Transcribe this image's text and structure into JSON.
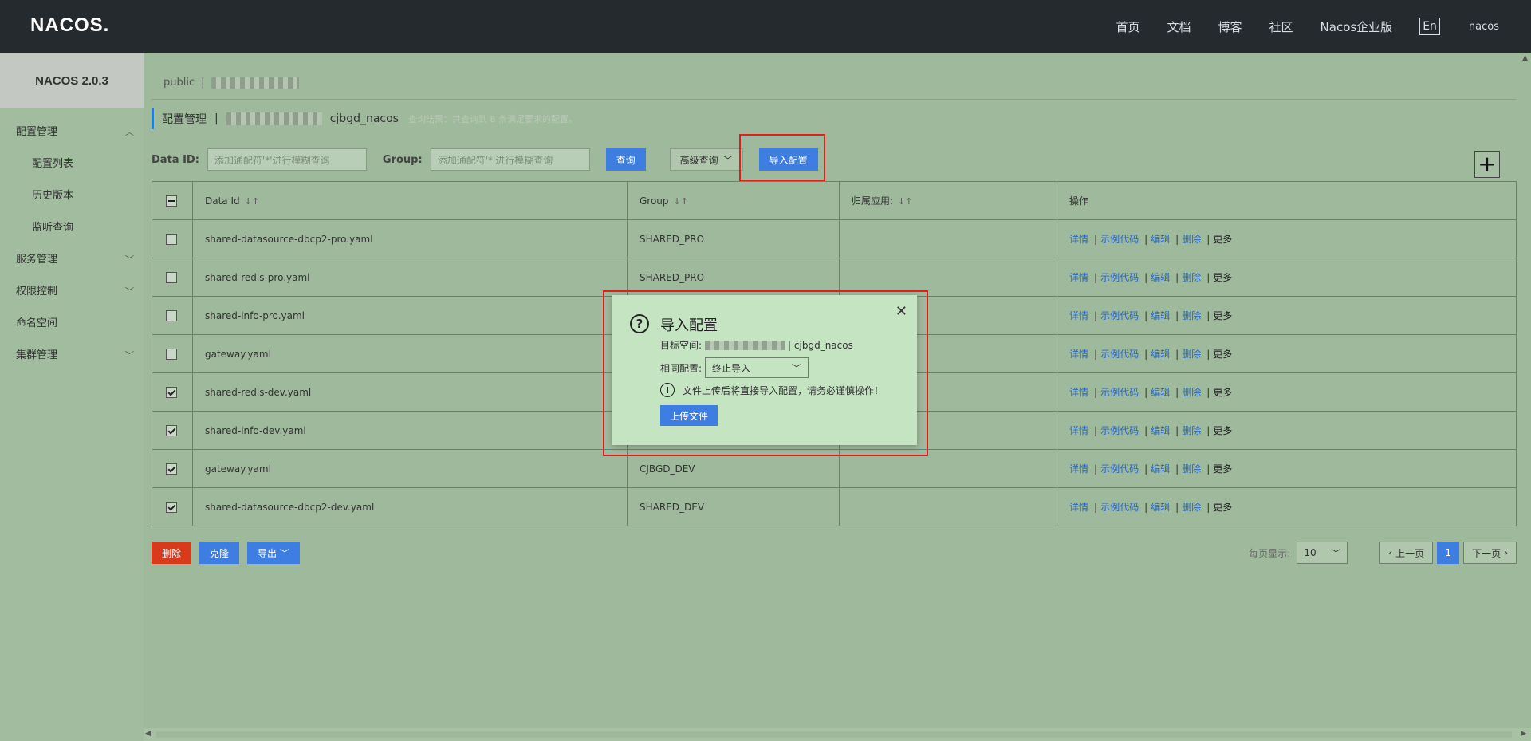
{
  "header": {
    "logo": "NACOS.",
    "nav": [
      "首页",
      "文档",
      "博客",
      "社区",
      "Nacos企业版"
    ],
    "lang": "En",
    "user": "nacos"
  },
  "sidebar": {
    "title": "NACOS 2.0.3",
    "items": [
      {
        "label": "配置管理",
        "arrow": "^"
      },
      {
        "label": "配置列表"
      },
      {
        "label": "历史版本"
      },
      {
        "label": "监听查询"
      },
      {
        "label": "服务管理",
        "arrow": "v"
      },
      {
        "label": "权限控制",
        "arrow": "v"
      },
      {
        "label": "命名空间"
      },
      {
        "label": "集群管理",
        "arrow": "v"
      }
    ]
  },
  "namespace_bar": {
    "public": "public",
    "sep": "|"
  },
  "crumb": {
    "title": "配置管理",
    "sep": "|",
    "ns_name": "cjbgd_nacos",
    "hint": "查询结果：共查询到 8 条满足要求的配置。"
  },
  "search": {
    "dataid_label": "Data ID:",
    "dataid_placeholder": "添加通配符'*'进行模糊查询",
    "group_label": "Group:",
    "group_placeholder": "添加通配符'*'进行模糊查询",
    "query_btn": "查询",
    "advanced_btn": "高级查询",
    "import_btn": "导入配置"
  },
  "table": {
    "columns": [
      "Data Id",
      "Group",
      "归属应用:",
      "操作"
    ],
    "ops": [
      "详情",
      "示例代码",
      "编辑",
      "删除",
      "更多"
    ],
    "rows": [
      {
        "data_id": "shared-datasource-dbcp2-pro.yaml",
        "group": "SHARED_PRO",
        "checked": false
      },
      {
        "data_id": "shared-redis-pro.yaml",
        "group": "SHARED_PRO",
        "checked": false
      },
      {
        "data_id": "shared-info-pro.yaml",
        "group": "",
        "checked": false
      },
      {
        "data_id": "gateway.yaml",
        "group": "",
        "checked": false
      },
      {
        "data_id": "shared-redis-dev.yaml",
        "group": "",
        "checked": true
      },
      {
        "data_id": "shared-info-dev.yaml",
        "group": "",
        "checked": true
      },
      {
        "data_id": "gateway.yaml",
        "group": "CJBGD_DEV",
        "checked": true
      },
      {
        "data_id": "shared-datasource-dbcp2-dev.yaml",
        "group": "SHARED_DEV",
        "checked": true
      }
    ]
  },
  "bottom": {
    "delete_btn": "删除",
    "clone_btn": "克隆",
    "export_btn": "导出",
    "page_size_label": "每页显示:",
    "page_size": "10",
    "prev": "上一页",
    "page": "1",
    "next": "下一页"
  },
  "dialog": {
    "title": "导入配置",
    "target_label": "目标空间:",
    "target_ns": "| cjbgd_nacos",
    "same_label": "相同配置:",
    "same_value": "终止导入",
    "warning": "文件上传后将直接导入配置，请务必谨慎操作！",
    "upload_btn": "上传文件"
  }
}
